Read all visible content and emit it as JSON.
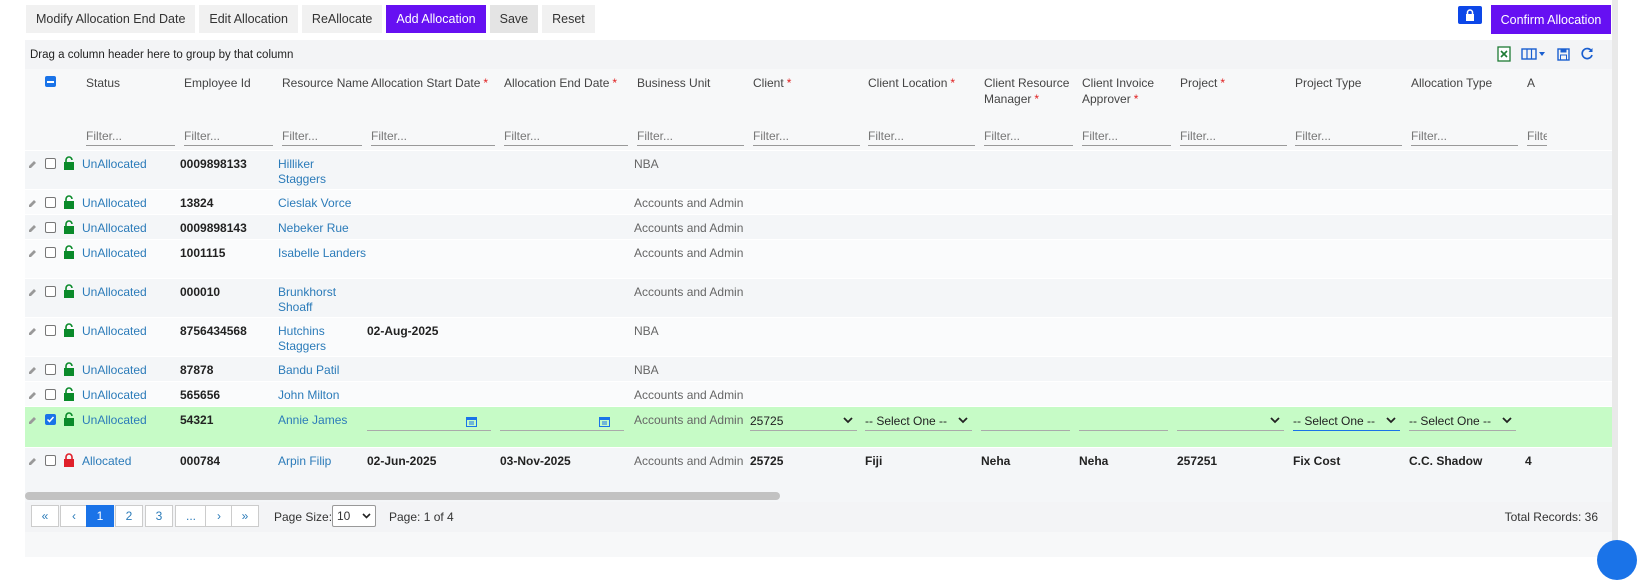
{
  "toolbar": {
    "modify_end_date": "Modify Allocation End Date",
    "edit_allocation": "Edit Allocation",
    "reallocate": "ReAllocate",
    "add_allocation": "Add Allocation",
    "save": "Save",
    "reset": "Reset",
    "confirm_allocation": "Confirm Allocation"
  },
  "grid": {
    "group_hint": "Drag a column header here to group by that column",
    "filter_placeholder": "Filter...",
    "columns": [
      {
        "label": "Status",
        "required": false
      },
      {
        "label": "Employee Id",
        "required": false
      },
      {
        "label": "Resource Name",
        "required": false
      },
      {
        "label": "Allocation Start Date",
        "required": true
      },
      {
        "label": "Allocation End Date",
        "required": true
      },
      {
        "label": "Business Unit",
        "required": false
      },
      {
        "label": "Client",
        "required": true
      },
      {
        "label": "Client Location",
        "required": true
      },
      {
        "label": "Client Resource Manager",
        "required": true
      },
      {
        "label": "Client Invoice Approver",
        "required": true
      },
      {
        "label": "Project",
        "required": true
      },
      {
        "label": "Project Type",
        "required": false
      },
      {
        "label": "Allocation Type",
        "required": false
      },
      {
        "label": "A",
        "required": false
      }
    ],
    "required_mark": "*",
    "rows": [
      {
        "status": "UnAllocated",
        "emp_id": "0009898133",
        "name_1": "Hilliker",
        "name_2": "Staggers",
        "start": "",
        "end": "",
        "bu": "NBA",
        "locked": false,
        "checked": false
      },
      {
        "status": "UnAllocated",
        "emp_id": "13824",
        "name_1": "Cieslak Vorce",
        "name_2": "",
        "start": "",
        "end": "",
        "bu": "Accounts and Admin",
        "locked": false,
        "checked": false
      },
      {
        "status": "UnAllocated",
        "emp_id": "0009898143",
        "name_1": "Nebeker Rue",
        "name_2": "",
        "start": "",
        "end": "",
        "bu": "Accounts and Admin",
        "locked": false,
        "checked": false
      },
      {
        "status": "UnAllocated",
        "emp_id": "1001115",
        "name_1": "Isabelle Landers",
        "name_2": "",
        "start": "",
        "end": "",
        "bu": "Accounts and Admin",
        "locked": false,
        "checked": false
      },
      {
        "status": "UnAllocated",
        "emp_id": "000010",
        "name_1": "Brunkhorst",
        "name_2": "Shoaff",
        "start": "",
        "end": "",
        "bu": "Accounts and Admin",
        "locked": false,
        "checked": false
      },
      {
        "status": "UnAllocated",
        "emp_id": "8756434568",
        "name_1": "Hutchins",
        "name_2": "Staggers",
        "start": "02-Aug-2025",
        "end": "",
        "bu": "NBA",
        "locked": false,
        "checked": false
      },
      {
        "status": "UnAllocated",
        "emp_id": "87878",
        "name_1": "Bandu Patil",
        "name_2": "",
        "start": "",
        "end": "",
        "bu": "NBA",
        "locked": false,
        "checked": false
      },
      {
        "status": "UnAllocated",
        "emp_id": "565656",
        "name_1": "John Milton",
        "name_2": "",
        "start": "",
        "end": "",
        "bu": "Accounts and Admin",
        "locked": false,
        "checked": false
      }
    ],
    "edit_row": {
      "status": "UnAllocated",
      "emp_id": "54321",
      "name": "Annie James",
      "bu": "Accounts and Admin",
      "client": "25725",
      "client_location": "-- Select One --",
      "project_type": "-- Select One --",
      "allocation_type": "-- Select One --"
    },
    "allocated_row": {
      "status": "Allocated",
      "emp_id": "000784",
      "name": "Arpin Filip",
      "start": "02-Jun-2025",
      "end": "03-Nov-2025",
      "bu": "Accounts and Admin",
      "client": "25725",
      "client_location": "Fiji",
      "crm": "Neha",
      "cia": "Neha",
      "project": "257251",
      "project_type": "Fix Cost",
      "allocation_type": "C.C. Shadow",
      "next": "4"
    }
  },
  "pager": {
    "first": "«",
    "prev": "‹",
    "pages": [
      "1",
      "2",
      "3",
      "..."
    ],
    "next": "›",
    "last": "»",
    "page_size_label": "Page Size:",
    "page_size": "10",
    "page_info": "Page: 1 of 4",
    "total": "Total Records: 36"
  },
  "colors": {
    "accent": "#6610f2",
    "link": "#2b7bb9",
    "unlocked": "#0a8a2a",
    "locked": "#e0202a",
    "selected_row": "#c6fbc6"
  }
}
